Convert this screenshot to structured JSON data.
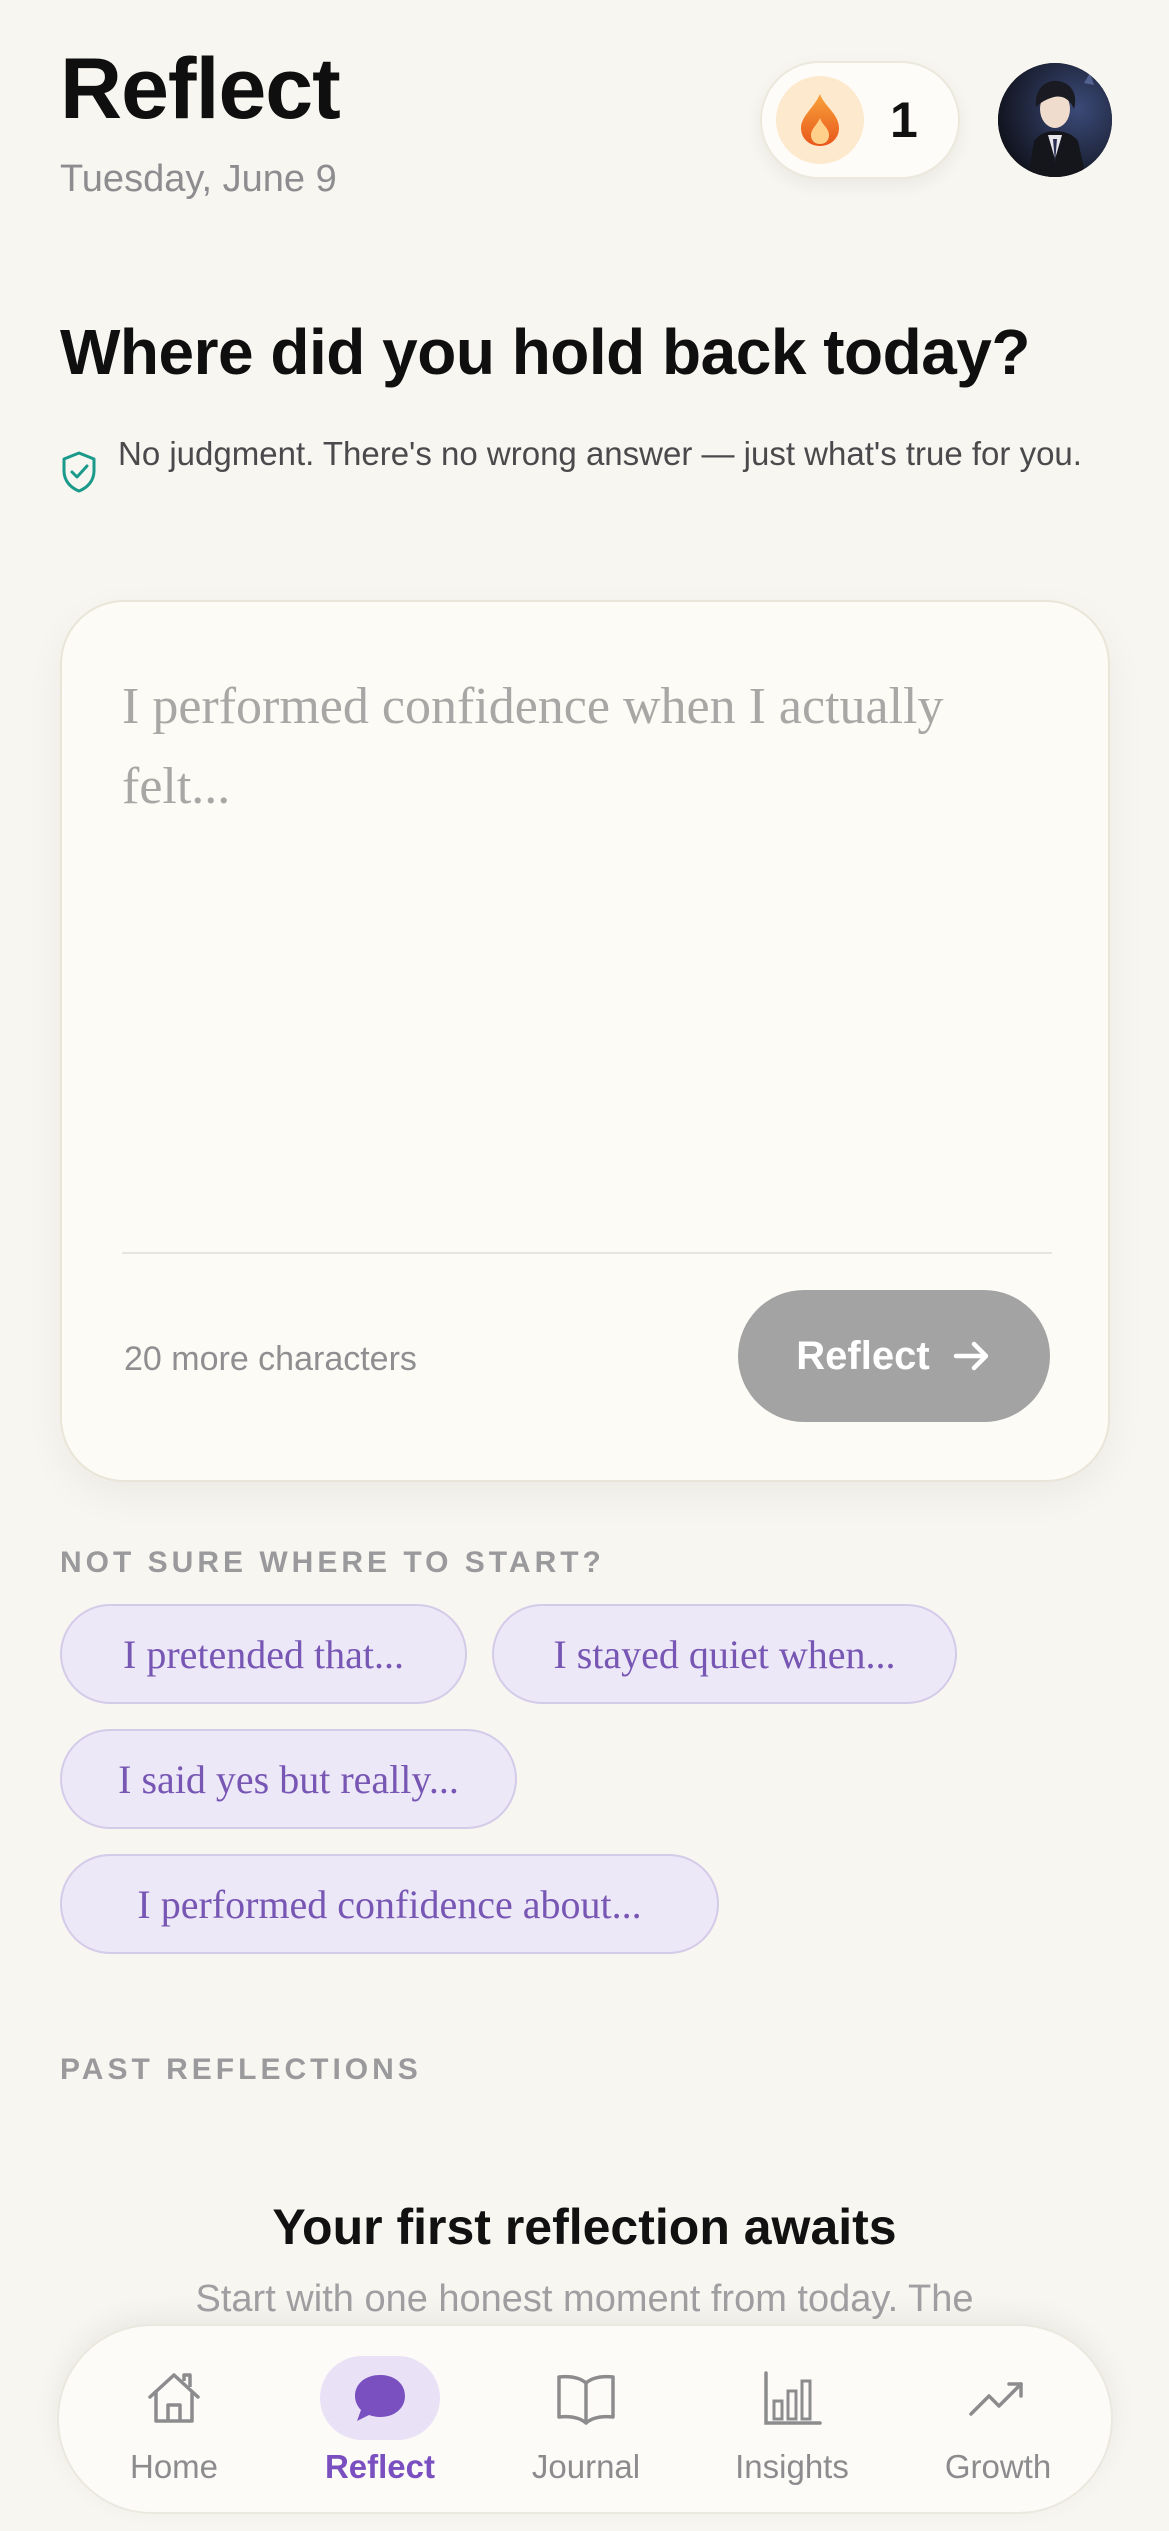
{
  "header": {
    "title": "Reflect",
    "date": "Tuesday, June 9",
    "streak_count": "1",
    "streak_icon": "flame-icon",
    "avatar_icon": "user-avatar"
  },
  "prompt": {
    "question": "Where did you hold back today?",
    "reassurance": "No judgment. There's no wrong answer — just what's true for you.",
    "reassurance_icon": "shield-check-icon"
  },
  "entry": {
    "placeholder": "I performed confidence when I actually felt...",
    "value": "",
    "char_hint": "20 more characters",
    "submit_label": "Reflect",
    "submit_icon": "arrow-right-icon"
  },
  "suggestions": {
    "label": "NOT SURE WHERE TO START?",
    "chips": [
      "I pretended that...",
      "I stayed quiet when...",
      "I said yes but really...",
      "I performed confidence about..."
    ]
  },
  "past": {
    "label": "PAST REFLECTIONS",
    "empty_title": "Your first reflection awaits",
    "empty_subtitle": "Start with one honest moment from today. The"
  },
  "nav": {
    "active": "Reflect",
    "items": [
      {
        "label": "Home",
        "icon": "home-icon"
      },
      {
        "label": "Reflect",
        "icon": "chat-bubble-icon"
      },
      {
        "label": "Journal",
        "icon": "book-icon"
      },
      {
        "label": "Insights",
        "icon": "bar-chart-icon"
      },
      {
        "label": "Growth",
        "icon": "trend-up-icon"
      }
    ]
  },
  "colors": {
    "background": "#f8f6f1",
    "accent": "#7a4fc0",
    "chip_bg": "#ede8f7",
    "button_disabled": "#a3a3a3",
    "shield": "#1a9a8a",
    "flame": "#f07a1a"
  }
}
